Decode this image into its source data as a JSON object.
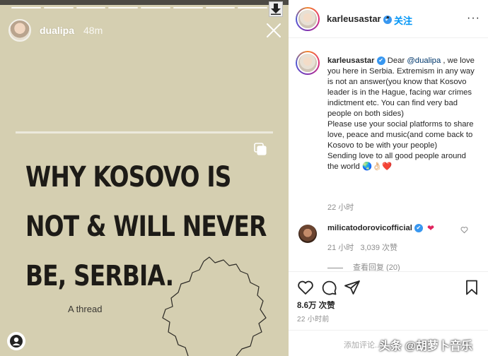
{
  "story": {
    "username": "dualipa",
    "time_ago": "48m",
    "headline_lines": [
      "WHY KOSOVO IS",
      "NOT & WILL NEVER",
      "BE, SERBIA."
    ],
    "subtext": "A thread",
    "progress_segments": 8
  },
  "post": {
    "header": {
      "username": "karleusastar",
      "dot": "•",
      "follow_label": "关注",
      "more": "···"
    },
    "caption": {
      "username": "karleusastar",
      "text_before_mention": " Dear ",
      "mention": "@dualipa",
      "text_after_mention": " , we love you here in Serbia. Extremism in any way is not an answer(you know that Kosovo leader is in the Hague, facing war crimes indictment etc. You can find very bad people on both sides)\nPlease use your social platforms to share love, peace and music(and come back to Kosovo to be with your people)\nSending love to all good people around the world 🌏👌🏻❤️",
      "time": "22 小时"
    },
    "comment": {
      "username": "milicatodorovicofficial",
      "emoji": "❤",
      "time": "21 小时",
      "likes": "3,039 次赞",
      "view_replies": "查看回复 (20)"
    },
    "likes": "8.6万 次赞",
    "post_time": "22 小时前",
    "comment_placeholder": "添加评论...",
    "watermark": "头条 @胡萝卜音乐"
  },
  "colors": {
    "story_bg": "#d5cfb1",
    "link_blue": "#0095f6",
    "heart_red": "#e0245e",
    "verified_blue": "#3897f0"
  }
}
